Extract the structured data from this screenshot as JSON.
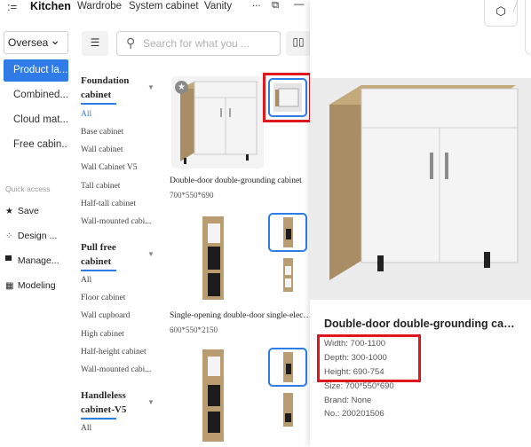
{
  "tabs": [
    "Kitchen",
    "Wardrobe",
    "System cabinet",
    "Vanity"
  ],
  "topbar": {
    "menu_icon": ":=",
    "more_icon": "...",
    "ext_icon": "⧉",
    "min_icon": "—"
  },
  "region": {
    "value": "Oversea",
    "chevron": "⌄"
  },
  "left_menu": [
    "Product la...",
    "Combined...",
    "Cloud mat...",
    "Free cabin..."
  ],
  "quick_access": {
    "label": "Quick access",
    "items": [
      {
        "icon": "star-icon",
        "label": "Save"
      },
      {
        "icon": "grid-icon",
        "label": "Design ..."
      },
      {
        "icon": "monitor-icon",
        "label": "Manage..."
      },
      {
        "icon": "modeling-icon",
        "label": "Modeling"
      }
    ]
  },
  "search": {
    "placeholder": "Search for what you ..."
  },
  "categories": {
    "foundation": {
      "title": "Foundation cabinet",
      "items": [
        "All",
        "Base cabinet",
        "Wall cabinet",
        "Wall Cabinet V5",
        "Tall cabinet",
        "Half-tall cabinet",
        "Wall-mounted cabi..."
      ]
    },
    "pull_free": {
      "title": "Pull free cabinet",
      "items": [
        "All",
        "Floor cabinet",
        "Wall cupboard",
        "High cabinet",
        "Half-height cabinet",
        "Wall-mounted cabi..."
      ]
    },
    "handleless": {
      "title": "Handleless cabinet-V5",
      "items": [
        "All"
      ]
    }
  },
  "products": [
    {
      "title": "Double-door double-grounding cabinet",
      "size": "700*550*690"
    },
    {
      "title": "Single-opening double-door single-elect...",
      "size": "600*550*2150"
    }
  ],
  "preview": {
    "title": "Double-door double-grounding cabi...",
    "specs": {
      "width": "Width:  700-1100",
      "depth": "Depth:  300-1000",
      "height": "Height:  690-754",
      "size": "Size:  700*550*690",
      "brand": "Brand:  None",
      "no": "No.:  200201506"
    }
  },
  "colors": {
    "accent": "#2f7be8",
    "highlight": "#e0181e",
    "wood": "#b59a72",
    "door": "#f4f4f4"
  }
}
